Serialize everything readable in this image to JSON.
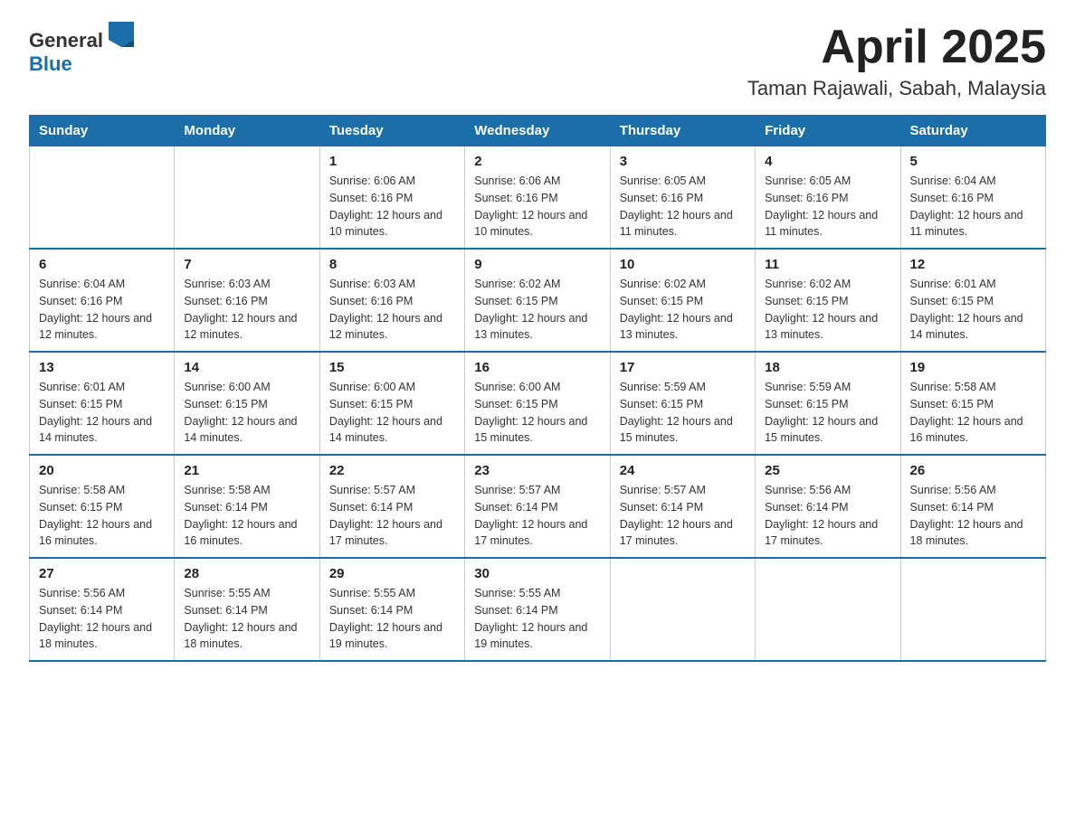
{
  "logo": {
    "general": "General",
    "blue": "Blue"
  },
  "title": "April 2025",
  "location": "Taman Rajawali, Sabah, Malaysia",
  "days_of_week": [
    "Sunday",
    "Monday",
    "Tuesday",
    "Wednesday",
    "Thursday",
    "Friday",
    "Saturday"
  ],
  "weeks": [
    [
      {
        "day": "",
        "detail": ""
      },
      {
        "day": "",
        "detail": ""
      },
      {
        "day": "1",
        "detail": "Sunrise: 6:06 AM\nSunset: 6:16 PM\nDaylight: 12 hours\nand 10 minutes."
      },
      {
        "day": "2",
        "detail": "Sunrise: 6:06 AM\nSunset: 6:16 PM\nDaylight: 12 hours\nand 10 minutes."
      },
      {
        "day": "3",
        "detail": "Sunrise: 6:05 AM\nSunset: 6:16 PM\nDaylight: 12 hours\nand 11 minutes."
      },
      {
        "day": "4",
        "detail": "Sunrise: 6:05 AM\nSunset: 6:16 PM\nDaylight: 12 hours\nand 11 minutes."
      },
      {
        "day": "5",
        "detail": "Sunrise: 6:04 AM\nSunset: 6:16 PM\nDaylight: 12 hours\nand 11 minutes."
      }
    ],
    [
      {
        "day": "6",
        "detail": "Sunrise: 6:04 AM\nSunset: 6:16 PM\nDaylight: 12 hours\nand 12 minutes."
      },
      {
        "day": "7",
        "detail": "Sunrise: 6:03 AM\nSunset: 6:16 PM\nDaylight: 12 hours\nand 12 minutes."
      },
      {
        "day": "8",
        "detail": "Sunrise: 6:03 AM\nSunset: 6:16 PM\nDaylight: 12 hours\nand 12 minutes."
      },
      {
        "day": "9",
        "detail": "Sunrise: 6:02 AM\nSunset: 6:15 PM\nDaylight: 12 hours\nand 13 minutes."
      },
      {
        "day": "10",
        "detail": "Sunrise: 6:02 AM\nSunset: 6:15 PM\nDaylight: 12 hours\nand 13 minutes."
      },
      {
        "day": "11",
        "detail": "Sunrise: 6:02 AM\nSunset: 6:15 PM\nDaylight: 12 hours\nand 13 minutes."
      },
      {
        "day": "12",
        "detail": "Sunrise: 6:01 AM\nSunset: 6:15 PM\nDaylight: 12 hours\nand 14 minutes."
      }
    ],
    [
      {
        "day": "13",
        "detail": "Sunrise: 6:01 AM\nSunset: 6:15 PM\nDaylight: 12 hours\nand 14 minutes."
      },
      {
        "day": "14",
        "detail": "Sunrise: 6:00 AM\nSunset: 6:15 PM\nDaylight: 12 hours\nand 14 minutes."
      },
      {
        "day": "15",
        "detail": "Sunrise: 6:00 AM\nSunset: 6:15 PM\nDaylight: 12 hours\nand 14 minutes."
      },
      {
        "day": "16",
        "detail": "Sunrise: 6:00 AM\nSunset: 6:15 PM\nDaylight: 12 hours\nand 15 minutes."
      },
      {
        "day": "17",
        "detail": "Sunrise: 5:59 AM\nSunset: 6:15 PM\nDaylight: 12 hours\nand 15 minutes."
      },
      {
        "day": "18",
        "detail": "Sunrise: 5:59 AM\nSunset: 6:15 PM\nDaylight: 12 hours\nand 15 minutes."
      },
      {
        "day": "19",
        "detail": "Sunrise: 5:58 AM\nSunset: 6:15 PM\nDaylight: 12 hours\nand 16 minutes."
      }
    ],
    [
      {
        "day": "20",
        "detail": "Sunrise: 5:58 AM\nSunset: 6:15 PM\nDaylight: 12 hours\nand 16 minutes."
      },
      {
        "day": "21",
        "detail": "Sunrise: 5:58 AM\nSunset: 6:14 PM\nDaylight: 12 hours\nand 16 minutes."
      },
      {
        "day": "22",
        "detail": "Sunrise: 5:57 AM\nSunset: 6:14 PM\nDaylight: 12 hours\nand 17 minutes."
      },
      {
        "day": "23",
        "detail": "Sunrise: 5:57 AM\nSunset: 6:14 PM\nDaylight: 12 hours\nand 17 minutes."
      },
      {
        "day": "24",
        "detail": "Sunrise: 5:57 AM\nSunset: 6:14 PM\nDaylight: 12 hours\nand 17 minutes."
      },
      {
        "day": "25",
        "detail": "Sunrise: 5:56 AM\nSunset: 6:14 PM\nDaylight: 12 hours\nand 17 minutes."
      },
      {
        "day": "26",
        "detail": "Sunrise: 5:56 AM\nSunset: 6:14 PM\nDaylight: 12 hours\nand 18 minutes."
      }
    ],
    [
      {
        "day": "27",
        "detail": "Sunrise: 5:56 AM\nSunset: 6:14 PM\nDaylight: 12 hours\nand 18 minutes."
      },
      {
        "day": "28",
        "detail": "Sunrise: 5:55 AM\nSunset: 6:14 PM\nDaylight: 12 hours\nand 18 minutes."
      },
      {
        "day": "29",
        "detail": "Sunrise: 5:55 AM\nSunset: 6:14 PM\nDaylight: 12 hours\nand 19 minutes."
      },
      {
        "day": "30",
        "detail": "Sunrise: 5:55 AM\nSunset: 6:14 PM\nDaylight: 12 hours\nand 19 minutes."
      },
      {
        "day": "",
        "detail": ""
      },
      {
        "day": "",
        "detail": ""
      },
      {
        "day": "",
        "detail": ""
      }
    ]
  ]
}
